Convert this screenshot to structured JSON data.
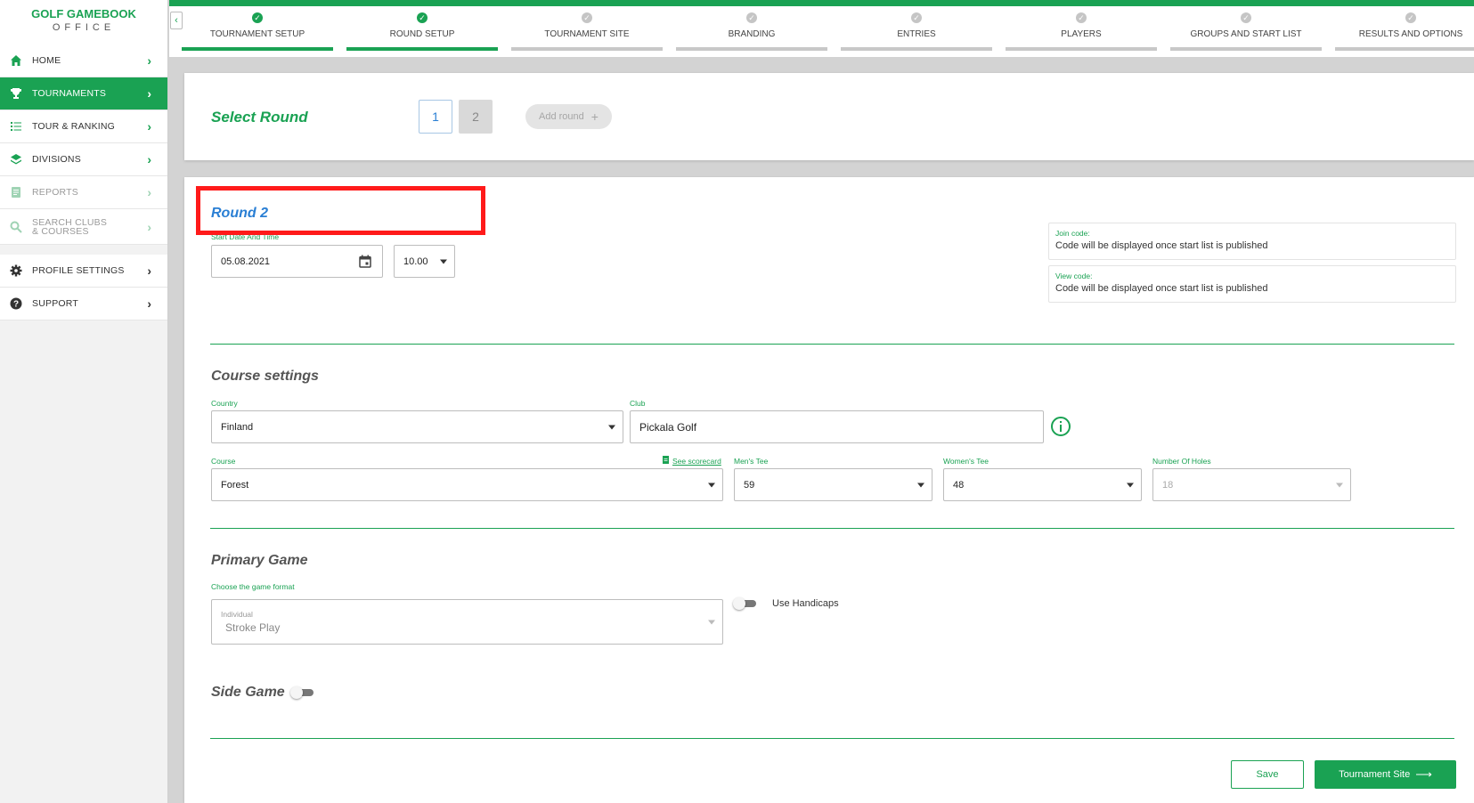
{
  "sidebar": {
    "logo": {
      "brand_a": "G",
      "brand_o": "O",
      "brand_b": "LF GAMEBOOK",
      "sub": "OFFICE"
    },
    "items": [
      {
        "label": "HOME",
        "icon": "home-icon"
      },
      {
        "label": "TOURNAMENTS",
        "icon": "trophy-icon",
        "active": true
      },
      {
        "label": "TOUR & RANKING",
        "icon": "list-icon"
      },
      {
        "label": "DIVISIONS",
        "icon": "layers-icon"
      },
      {
        "label": "REPORTS",
        "icon": "report-icon",
        "disabled": true
      },
      {
        "label": "SEARCH CLUBS & COURSES",
        "icon": "search-icon",
        "disabled": true
      },
      {
        "label": "PROFILE SETTINGS",
        "icon": "gear-icon"
      },
      {
        "label": "SUPPORT",
        "icon": "help-icon"
      }
    ]
  },
  "stepper": {
    "steps": [
      {
        "label": "TOURNAMENT SETUP",
        "done": true
      },
      {
        "label": "ROUND SETUP",
        "done": true
      },
      {
        "label": "TOURNAMENT SITE",
        "done": false
      },
      {
        "label": "BRANDING",
        "done": false
      },
      {
        "label": "ENTRIES",
        "done": false
      },
      {
        "label": "PLAYERS",
        "done": false
      },
      {
        "label": "GROUPS AND START LIST",
        "done": false
      },
      {
        "label": "RESULTS AND OPTIONS",
        "done": false
      }
    ]
  },
  "select_round": {
    "title": "Select Round",
    "rounds": [
      "1",
      "2"
    ],
    "add_round": "Add round",
    "add_symbol": "+"
  },
  "round": {
    "title": "Round 2",
    "start_label": "Start Date And Time",
    "date": "05.08.2021",
    "time": "10.00",
    "join_code_label": "Join code:",
    "join_code_value": "Code will be displayed once start list is published",
    "view_code_label": "View code:",
    "view_code_value": "Code will be displayed once start list is published"
  },
  "course_settings": {
    "title": "Course settings",
    "country_label": "Country",
    "country": "Finland",
    "club_label": "Club",
    "club": "Pickala Golf",
    "course_label": "Course",
    "see_scorecard": "See scorecard",
    "course": "Forest",
    "mens_tee_label": "Men's Tee",
    "mens_tee": "59",
    "womens_tee_label": "Women's Tee",
    "womens_tee": "48",
    "holes_label": "Number Of Holes",
    "holes": "18"
  },
  "primary_game": {
    "title": "Primary Game",
    "format_label": "Choose the game format",
    "format_group": "Individual",
    "format": "Stroke Play",
    "use_handicaps": "Use Handicaps"
  },
  "side_game": {
    "title": "Side Game"
  },
  "actions": {
    "save": "Save",
    "next": "Tournament Site",
    "next_arrow": "⟶"
  },
  "colors": {
    "accent": "#1aa253",
    "link_blue": "#2a7fd4",
    "highlight": "#ff1a1a"
  }
}
